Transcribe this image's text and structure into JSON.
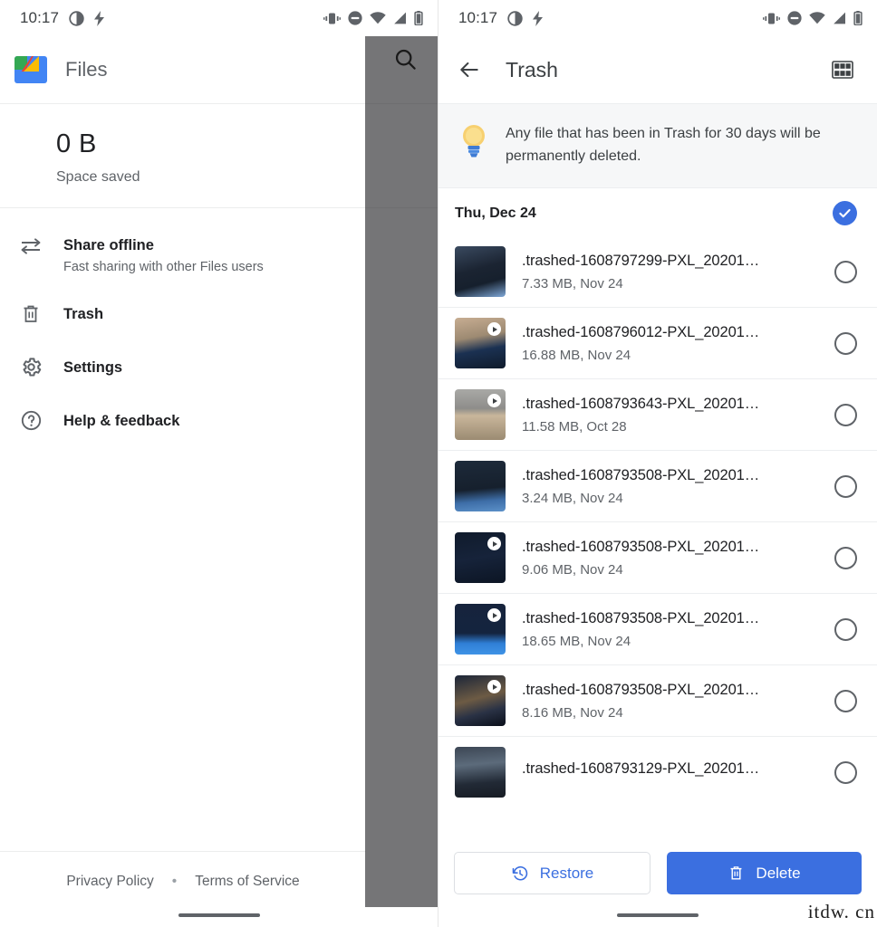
{
  "status_bar": {
    "time": "10:17",
    "icons": [
      "theme-circle-icon",
      "flash-icon",
      "vibrate-icon",
      "do-not-disturb-icon",
      "wifi-icon",
      "signal-icon",
      "battery-icon"
    ]
  },
  "drawer": {
    "app_title": "Files",
    "logo_icon": "files-logo-icon",
    "storage": {
      "value": "0 B",
      "label": "Space saved"
    },
    "items": [
      {
        "label": "Share offline",
        "sub": "Fast sharing with other Files users",
        "icon": "swap-arrows-icon"
      },
      {
        "label": "Trash",
        "sub": "",
        "icon": "trash-icon"
      },
      {
        "label": "Settings",
        "sub": "",
        "icon": "gear-icon"
      },
      {
        "label": "Help & feedback",
        "sub": "",
        "icon": "help-circle-icon"
      }
    ],
    "footer": {
      "privacy": "Privacy Policy",
      "separator": "•",
      "terms": "Terms of Service"
    }
  },
  "scrim": {
    "search_icon": "search-icon"
  },
  "trash": {
    "back_icon": "back-arrow-icon",
    "title": "Trash",
    "grid_icon": "grid-view-icon",
    "banner": {
      "icon": "lightbulb-icon",
      "text": "Any file that has been in Trash for 30 days will be permanently deleted."
    },
    "date_group": {
      "label": "Thu, Dec 24",
      "selected": true
    },
    "files": [
      {
        "name": ".trashed-1608797299-PXL_20201…",
        "sub": "7.33 MB, Nov 24",
        "video": false,
        "selected": false,
        "c1": "#2d3b52",
        "c2": "#8fa6c4",
        "c3": "#1a2433"
      },
      {
        "name": ".trashed-1608796012-PXL_20201…",
        "sub": "16.88 MB, Nov 24",
        "video": true,
        "selected": false,
        "c1": "#b9a089",
        "c2": "#1d3557",
        "c3": "#0f1b2b"
      },
      {
        "name": ".trashed-1608793643-PXL_20201…",
        "sub": "11.58 MB, Oct 28",
        "video": true,
        "selected": false,
        "c1": "#9a9a98",
        "c2": "#c8b49a",
        "c3": "#6b6256"
      },
      {
        "name": ".trashed-1608793508-PXL_20201…",
        "sub": "3.24 MB, Nov 24",
        "video": false,
        "selected": false,
        "c1": "#1c2735",
        "c2": "#4a7ab5",
        "c3": "#121a26"
      },
      {
        "name": ".trashed-1608793508-PXL_20201…",
        "sub": "9.06 MB, Nov 24",
        "video": true,
        "selected": false,
        "c1": "#0e1828",
        "c2": "#16233a",
        "c3": "#0a111d"
      },
      {
        "name": ".trashed-1608793508-PXL_20201…",
        "sub": "18.65 MB, Nov 24",
        "video": true,
        "selected": false,
        "c1": "#13203a",
        "c2": "#2f7fd6",
        "c3": "#0c1526"
      },
      {
        "name": ".trashed-1608793508-PXL_20201…",
        "sub": "8.16 MB, Nov 24",
        "video": true,
        "selected": false,
        "c1": "#121c2e",
        "c2": "#7d6a52",
        "c3": "#0a0f1a"
      },
      {
        "name": ".trashed-1608793129-PXL_20201…",
        "sub": "",
        "video": false,
        "selected": false,
        "c1": "#2b3340",
        "c2": "#4c5b6b",
        "c3": "#171c24"
      }
    ],
    "actions": {
      "restore_label": "Restore",
      "restore_icon": "restore-clock-icon",
      "delete_label": "Delete",
      "delete_icon": "trash-icon"
    }
  },
  "watermark": "itdw. cn",
  "colors": {
    "accent": "#3b6fe0",
    "scrim": "rgba(32,33,36,.62)",
    "text_primary": "#202124",
    "text_secondary": "#5f6368"
  }
}
